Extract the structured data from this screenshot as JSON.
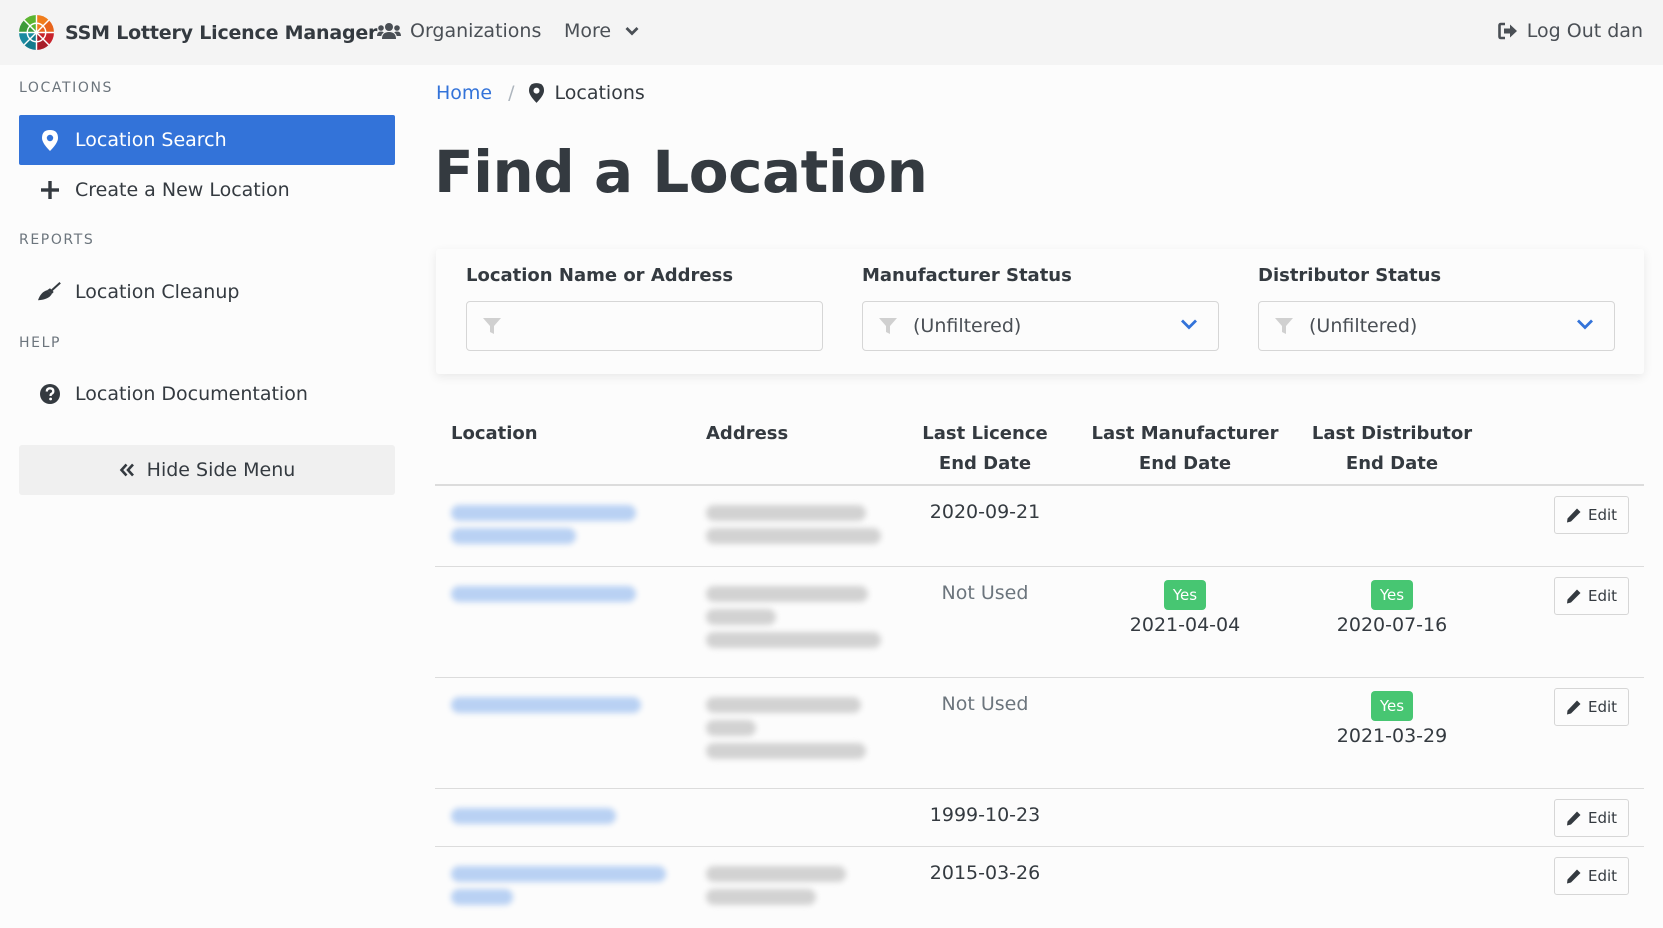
{
  "navbar": {
    "app_title": "SSM Lottery Licence Manager",
    "organizations_label": "Organizations",
    "more_label": "More",
    "logout_label": "Log Out dan"
  },
  "sidebar": {
    "sections": [
      {
        "heading": "LOCATIONS",
        "items": [
          {
            "label": "Location Search",
            "icon": "map-marker-icon",
            "active": true
          },
          {
            "label": "Create a New Location",
            "icon": "plus-icon",
            "active": false
          }
        ]
      },
      {
        "heading": "REPORTS",
        "items": [
          {
            "label": "Location Cleanup",
            "icon": "broom-icon",
            "active": false
          }
        ]
      },
      {
        "heading": "HELP",
        "items": [
          {
            "label": "Location Documentation",
            "icon": "question-circle-icon",
            "active": false
          }
        ]
      }
    ],
    "hide_menu_label": "Hide Side Menu"
  },
  "breadcrumb": {
    "home": "Home",
    "separator": "/",
    "current": "Locations"
  },
  "page_title": "Find a Location",
  "filters": {
    "name_label": "Location Name or Address",
    "name_value": "",
    "manufacturer_label": "Manufacturer Status",
    "manufacturer_value": "(Unfiltered)",
    "distributor_label": "Distributor Status",
    "distributor_value": "(Unfiltered)"
  },
  "table": {
    "headers": {
      "location": "Location",
      "address": "Address",
      "licence_line1": "Last Licence",
      "licence_line2": "End Date",
      "manufacturer_line1": "Last Manufacturer",
      "manufacturer_line2": "End Date",
      "distributor_line1": "Last Distributor",
      "distributor_line2": "End Date"
    },
    "edit_label": "Edit",
    "badge_label": "Yes",
    "rows": [
      {
        "location": "[redacted]",
        "address": "[redacted]",
        "licence": "2020-09-21",
        "manufacturer": "",
        "manufacturer_badge": false,
        "distributor": "",
        "distributor_badge": false
      },
      {
        "location": "[redacted]",
        "address": "[redacted]",
        "licence": "Not Used",
        "manufacturer": "2021-04-04",
        "manufacturer_badge": true,
        "distributor": "2020-07-16",
        "distributor_badge": true
      },
      {
        "location": "[redacted]",
        "address": "[redacted]",
        "licence": "Not Used",
        "manufacturer": "",
        "manufacturer_badge": false,
        "distributor": "2021-03-29",
        "distributor_badge": true
      },
      {
        "location": "[redacted]",
        "address": "",
        "licence": "1999-10-23",
        "manufacturer": "",
        "manufacturer_badge": false,
        "distributor": "",
        "distributor_badge": false
      },
      {
        "location": "[redacted]",
        "address": "[redacted]",
        "licence": "2015-03-26",
        "manufacturer": "",
        "manufacturer_badge": false,
        "distributor": "",
        "distributor_badge": false
      }
    ]
  },
  "colors": {
    "primary": "#3373d9",
    "success_badge": "#47c672",
    "navbar_bg": "#f4f4f4"
  }
}
